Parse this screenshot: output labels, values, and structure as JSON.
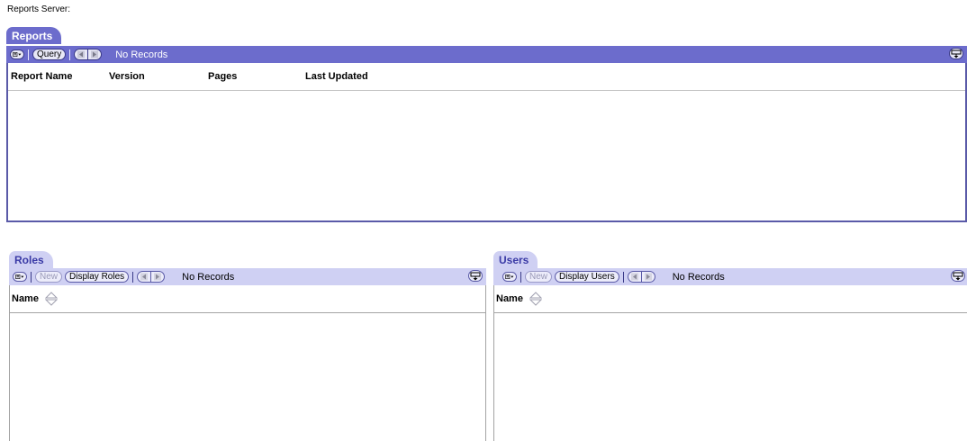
{
  "page": {
    "title": "Reports Server:"
  },
  "reports": {
    "tab_label": "Reports",
    "toolbar": {
      "query_label": "Query",
      "status": "No Records"
    },
    "columns": [
      "Report Name",
      "Version",
      "Pages",
      "Last Updated"
    ]
  },
  "roles": {
    "tab_label": "Roles",
    "toolbar": {
      "new_label": "New",
      "display_label": "Display Roles",
      "status": "No Records"
    },
    "columns": [
      "Name"
    ]
  },
  "users": {
    "tab_label": "Users",
    "toolbar": {
      "new_label": "New",
      "display_label": "Display Users",
      "status": "No Records"
    },
    "columns": [
      "Name"
    ]
  },
  "icons": {
    "menu": "list-menu-icon",
    "prev": "prev-arrow-icon",
    "next": "next-arrow-icon",
    "export": "export-icon",
    "sort": "sort-icon"
  },
  "colors": {
    "dark_header": "#6c6ccc",
    "light_header": "#cfd0f3",
    "border": "#5a5aa8"
  }
}
